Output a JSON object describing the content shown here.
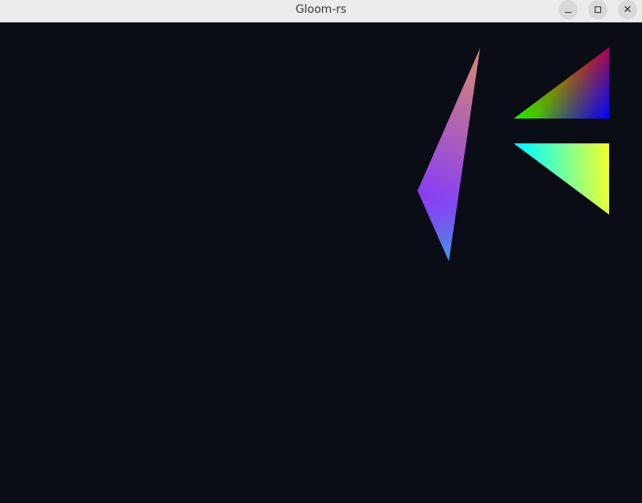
{
  "window": {
    "title": "Gloom-rs",
    "controls": {
      "minimize_icon": "minimize-icon",
      "maximize_icon": "maximize-icon",
      "close_icon": "close-icon"
    }
  },
  "viewport": {
    "background": "#0a0d16"
  },
  "colors": {
    "titlebar_bg": "#ebebeb",
    "button_bg": "#d8d8d8",
    "tri_left": [
      "#d88a6e",
      "#8a3ff2",
      "#3aa1e3"
    ],
    "tri_top_right": [
      "#f20010",
      "#22ee00",
      "#0000ff"
    ],
    "tri_bottom_right": [
      "#00ffff",
      "#f7ff2a",
      "#00ffff"
    ]
  }
}
